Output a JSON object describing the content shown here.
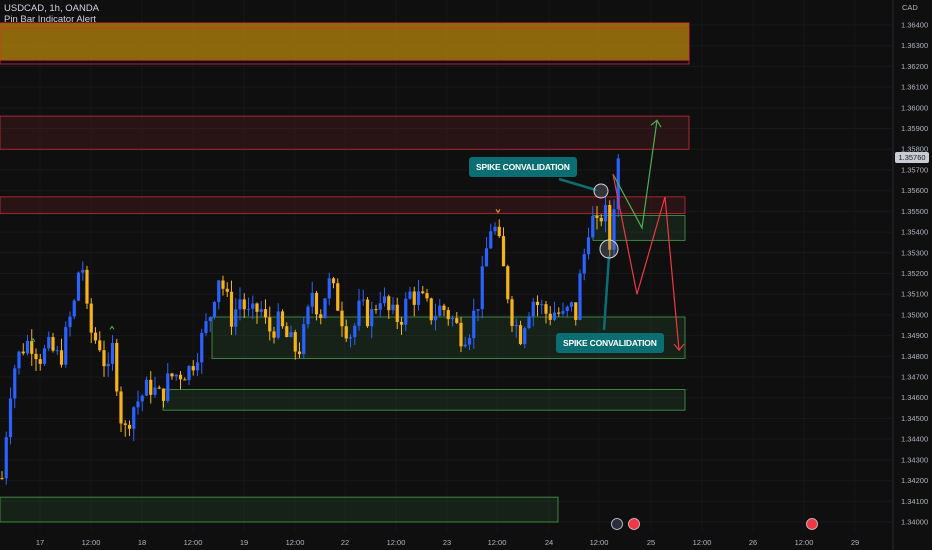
{
  "header": {
    "symbol_line": "USDCAD, 1h, OANDA",
    "indicator_line": "Pin Bar Indicator Alert"
  },
  "price_axis": {
    "currency": "CAD",
    "current_price": "1.35760"
  },
  "annotations": {
    "callout_upper": "SPIKE CONVALIDATION",
    "callout_lower": "SPIKE CONVALIDATION"
  },
  "colors": {
    "background": "#0f0f10",
    "bull_candle": "#2962ff",
    "bear_candle": "#f5b21b",
    "resistance_zone": "#e0303b",
    "gold_zone": "#b8860b",
    "support_zone": "#4caf50",
    "bullish_path": "#4caf50",
    "bearish_path": "#f23645",
    "callout": "#0b6e72"
  },
  "chart_data": {
    "type": "candlestick",
    "symbol": "USDCAD",
    "timeframe": "1h",
    "source": "OANDA",
    "y_ticks": [
      "1.36400",
      "1.36300",
      "1.36200",
      "1.36100",
      "1.36000",
      "1.35900",
      "1.35800",
      "1.35700",
      "1.35600",
      "1.35500",
      "1.35400",
      "1.35300",
      "1.35200",
      "1.35100",
      "1.35000",
      "1.34900",
      "1.34800",
      "1.34700",
      "1.34600",
      "1.34500",
      "1.34400",
      "1.34300",
      "1.34200",
      "1.34100",
      "1.34000"
    ],
    "x_ticks": [
      "17",
      "12:00",
      "18",
      "12:00",
      "19",
      "12:00",
      "22",
      "12:00",
      "23",
      "12:00",
      "24",
      "12:00",
      "25",
      "12:00",
      "26",
      "12:00",
      "29"
    ],
    "ylim": [
      1.3397,
      1.3658
    ],
    "zones": [
      {
        "kind": "resistance",
        "low": 1.3623,
        "high": 1.3641,
        "fill": "gold"
      },
      {
        "kind": "resistance",
        "low": 1.358,
        "high": 1.3596
      },
      {
        "kind": "resistance",
        "low": 1.3549,
        "high": 1.3557
      },
      {
        "kind": "support",
        "low": 1.3536,
        "high": 1.3548
      },
      {
        "kind": "support",
        "low": 1.3479,
        "high": 1.3499
      },
      {
        "kind": "support",
        "low": 1.3454,
        "high": 1.3464
      },
      {
        "kind": "support",
        "low": 1.34,
        "high": 1.3412
      }
    ],
    "bullish_projection": [
      1.3568,
      1.3542,
      1.3594
    ],
    "bearish_projection": [
      1.3568,
      1.351,
      1.3557,
      1.3483
    ],
    "last_close": 1.3576
  }
}
